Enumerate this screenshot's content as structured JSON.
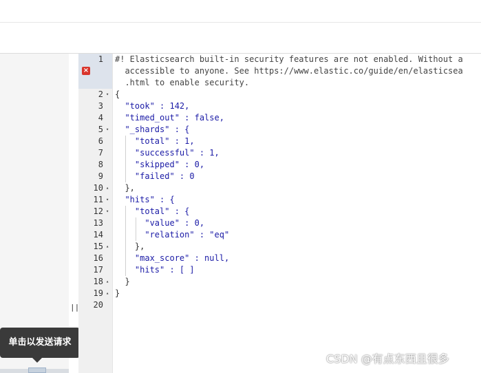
{
  "tooltip": {
    "text": "单击以发送请求"
  },
  "splitter": {
    "handle": "||"
  },
  "error_icon": {
    "glyph": "×"
  },
  "watermark": {
    "text": "CSDN @有点东西且很多"
  },
  "editor": {
    "line_numbers": [
      "1",
      "2",
      "3",
      "4",
      "5",
      "6",
      "7",
      "8",
      "9",
      "10",
      "11",
      "12",
      "13",
      "14",
      "15",
      "16",
      "17",
      "18",
      "19",
      "20"
    ],
    "lines": [
      [
        "#! Elasticsearch built-in security features are not enabled. Without a"
      ],
      [
        "  accessible to anyone. See https://www.elastic.co/guide/en/elasticsea"
      ],
      [
        "  .html to enable security."
      ],
      [
        "{"
      ],
      [
        "  \"took\" : 142,"
      ],
      [
        "  \"timed_out\" : false,"
      ],
      [
        "  \"_shards\" : {"
      ],
      [
        "    \"total\" : 1,"
      ],
      [
        "    \"successful\" : 1,"
      ],
      [
        "    \"skipped\" : 0,"
      ],
      [
        "    \"failed\" : 0"
      ],
      [
        "  },"
      ],
      [
        "  \"hits\" : {"
      ],
      [
        "    \"total\" : {"
      ],
      [
        "      \"value\" : 0,"
      ],
      [
        "      \"relation\" : \"eq\""
      ],
      [
        "    },"
      ],
      [
        "    \"max_score\" : null,"
      ],
      [
        "    \"hits\" : [ ]"
      ],
      [
        "  }"
      ],
      [
        "}"
      ]
    ],
    "fold_markers": {
      "down": "▾",
      "up": "▴"
    }
  },
  "colors": {
    "gutter_active": "#dde3ec",
    "error": "#d9352c",
    "tooltip_bg": "#3a3a3a",
    "string": "#1a7f37",
    "key": "#1a1aa6",
    "number": "#0000cd",
    "boolean": "#6f42c1"
  }
}
